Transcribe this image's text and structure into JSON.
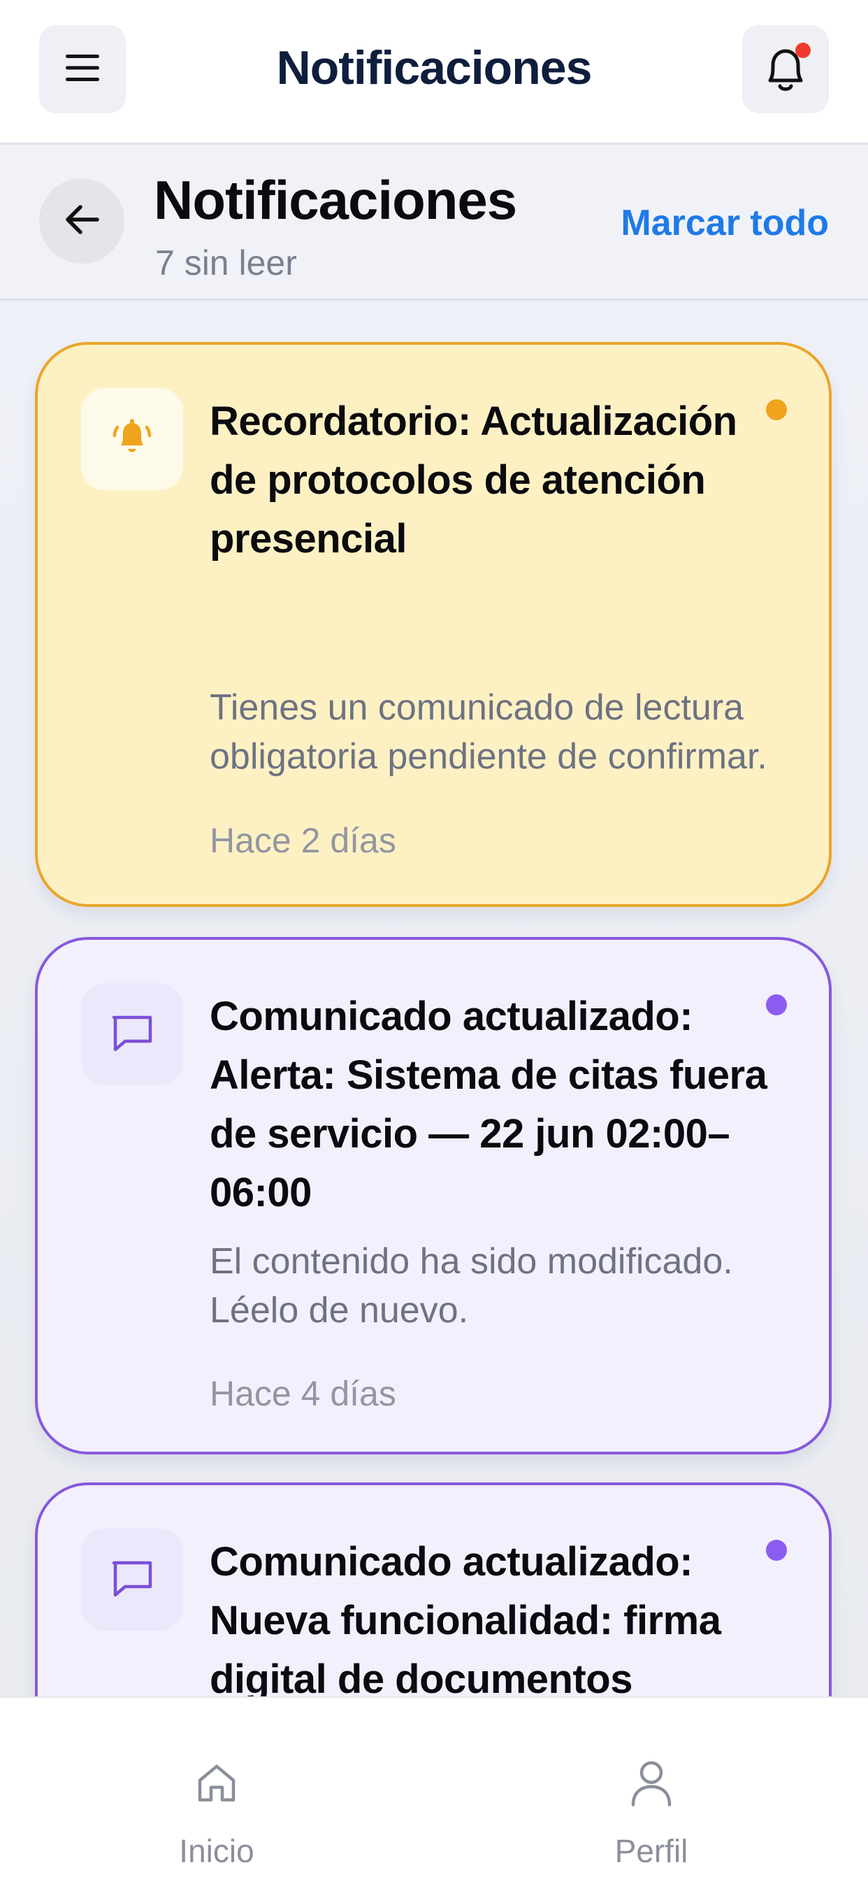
{
  "topbar": {
    "title": "Notificaciones",
    "menu_icon": "menu-icon",
    "bell_icon": "bell-icon",
    "has_unread_badge": true,
    "badge_color": "#ef3b2d"
  },
  "subheader": {
    "title": "Notificaciones",
    "unread_count": "7 sin leer",
    "mark_all": "Marcar todo",
    "back_icon": "arrow-left-icon"
  },
  "notifications": [
    {
      "type": "reminder",
      "icon": "bell-ringing-icon",
      "title": "Recordatorio: Actualización de protocolos de atención presencial",
      "body": "Tienes un comunicado de lectura obligatoria pendiente de confirmar.",
      "time": "Hace 2 días",
      "unread": true,
      "accent": "#eba52a"
    },
    {
      "type": "update",
      "icon": "message-square-icon",
      "title": "Comunicado actualizado: Alerta: Sistema de citas fuera de servicio — 22 jun 02:00–06:00",
      "body": "El contenido ha sido modificado. Léelo de nuevo.",
      "time": "Hace 4 días",
      "unread": true,
      "accent": "#8659dd"
    },
    {
      "type": "update",
      "icon": "message-square-icon",
      "title": "Comunicado actualizado: Nueva funcionalidad: firma digital de documentos disponible",
      "body": "",
      "time": "",
      "unread": true,
      "accent": "#8659dd"
    }
  ],
  "bottom_nav": [
    {
      "label": "Inicio",
      "icon": "home-icon"
    },
    {
      "label": "Perfil",
      "icon": "user-icon"
    }
  ],
  "colors": {
    "link": "#1e7ae6",
    "reminder_bg": "#fdf1c4",
    "update_bg": "#f3f0fd"
  }
}
